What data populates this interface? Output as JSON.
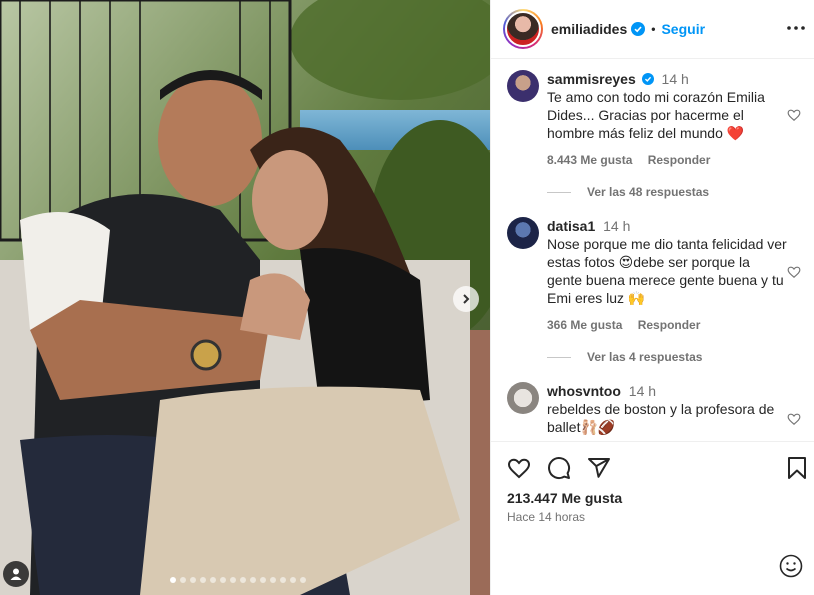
{
  "header": {
    "username": "emiliadides",
    "separator": "•",
    "follow_label": "Seguir"
  },
  "comments": [
    {
      "username": "sammisreyes",
      "verified": true,
      "time": "14 h",
      "text": "Te amo con todo mi corazón Emilia Dides... Gracias por hacerme el hombre más feliz del mundo ❤️",
      "likes": "8.443 Me gusta",
      "reply_label": "Responder",
      "view_replies": "Ver las 48 respuestas"
    },
    {
      "username": "datisa1",
      "verified": false,
      "time": "14 h",
      "text": "Nose porque me dio tanta felicidad ver estas fotos 😍debe ser porque la gente buena merece gente buena y tu Emi eres luz 🙌",
      "likes": "366 Me gusta",
      "reply_label": "Responder",
      "view_replies": "Ver las 4 respuestas"
    },
    {
      "username": "whosvntoo",
      "verified": false,
      "time": "14 h",
      "text": "rebeldes de boston y la profesora de ballet🩰🏈"
    }
  ],
  "footer": {
    "likes": "213.447 Me gusta",
    "time_ago": "Hace 14 horas"
  },
  "colors": {
    "accent": "#0095f6",
    "verified": "#0095f6",
    "muted": "#737373",
    "heart_red": "#ed4956"
  },
  "icons": {
    "like": "heart-icon",
    "comment": "comment-icon",
    "share": "send-icon",
    "save": "bookmark-icon",
    "emoji": "emoji-icon",
    "more": "more-icon",
    "next": "chevron-right-icon",
    "tags": "user-tag-icon"
  },
  "carousel": {
    "total": 14,
    "active": 1
  }
}
